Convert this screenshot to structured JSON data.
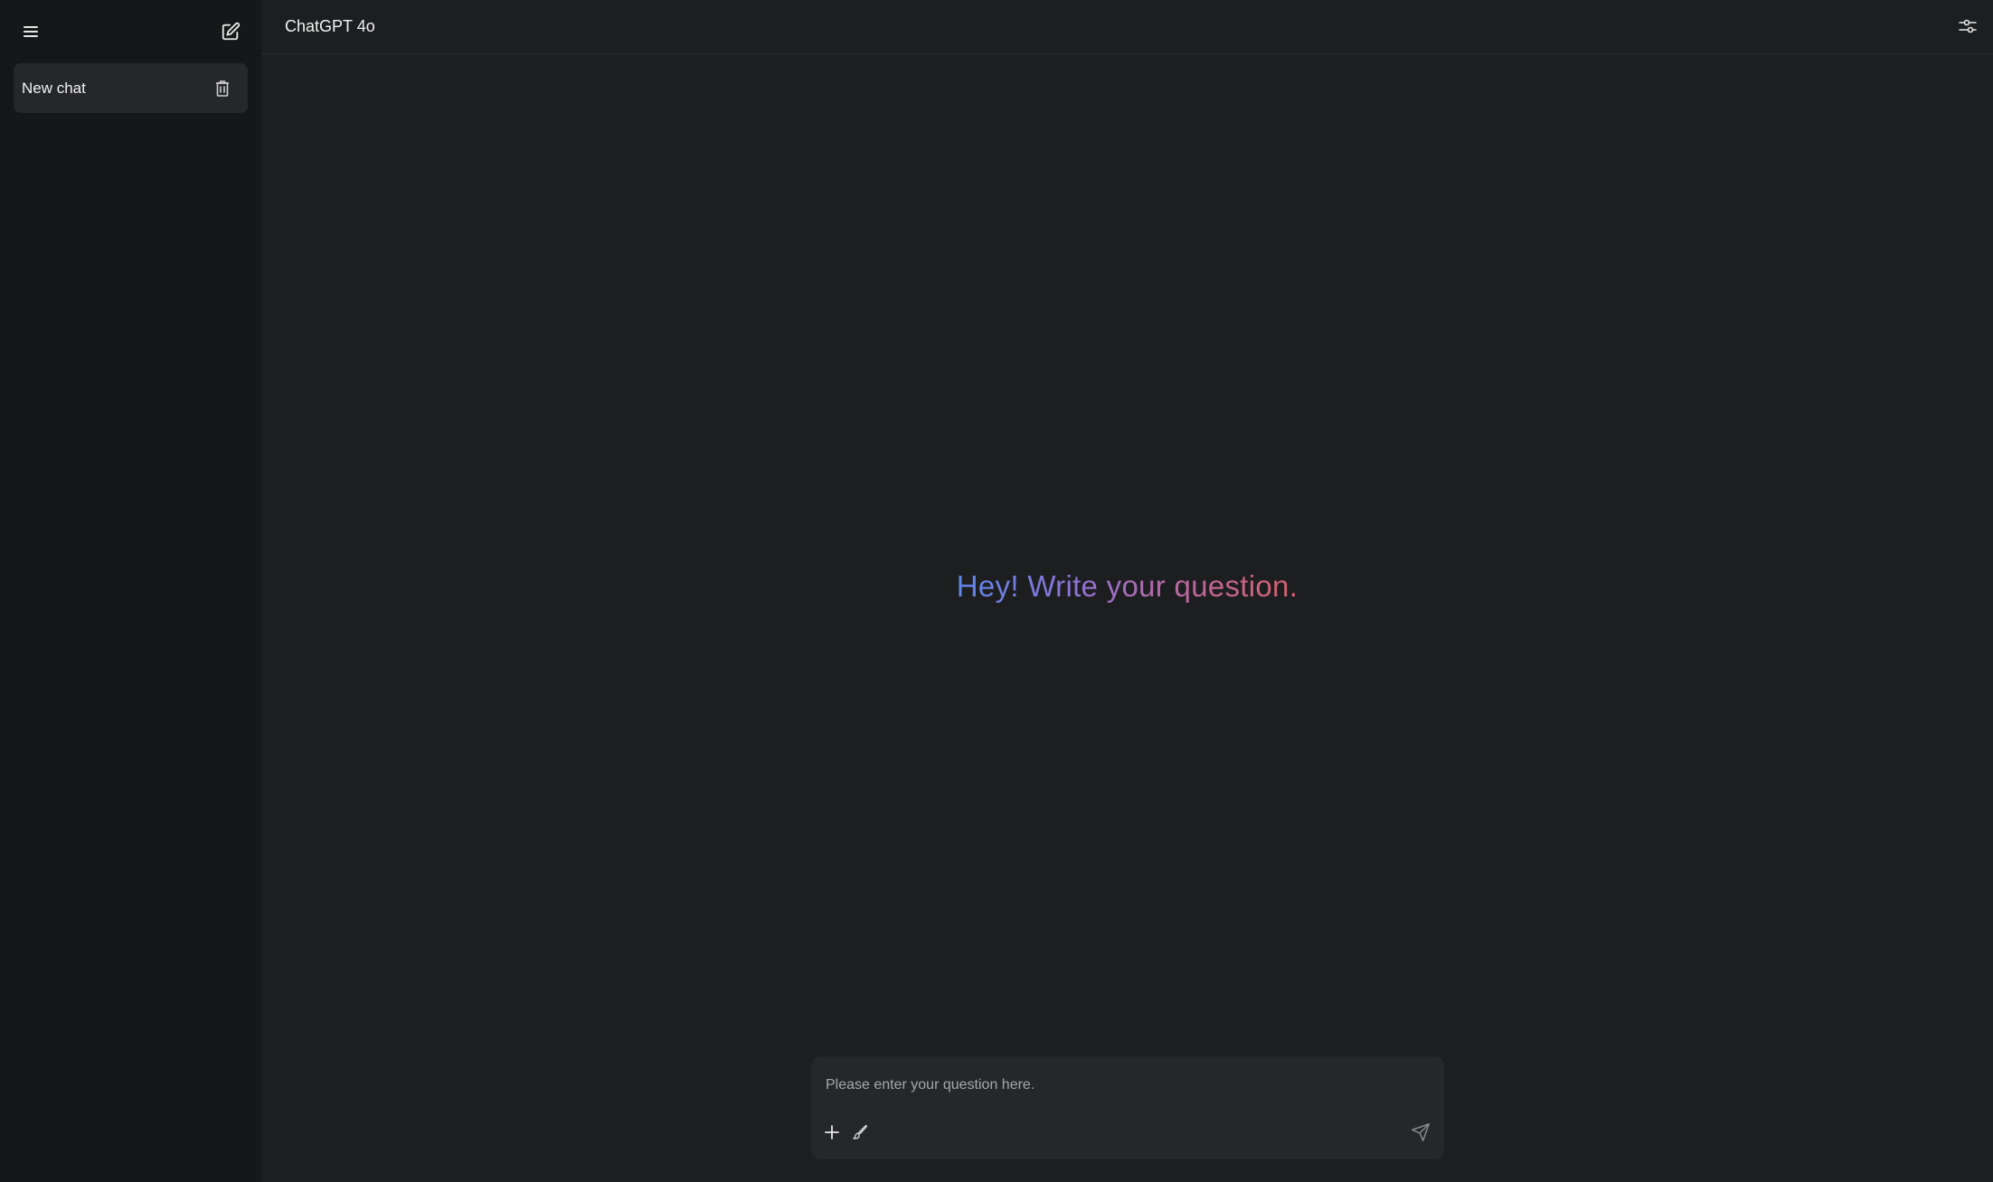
{
  "sidebar": {
    "menu_icon": "hamburger-menu-icon",
    "new_chat_icon": "edit-square-icon",
    "chats": [
      {
        "label": "New chat",
        "delete_icon": "trash-icon"
      }
    ]
  },
  "header": {
    "title": "ChatGPT 4o",
    "settings_icon": "sliders-icon"
  },
  "main": {
    "welcome": "Hey! Write your question."
  },
  "composer": {
    "placeholder": "Please enter your question here.",
    "value": "",
    "attach_icon": "plus-icon",
    "brush_icon": "brush-icon",
    "send_icon": "send-icon"
  },
  "colors": {
    "background": "#1d1e20",
    "sidebar": "#161718",
    "panel": "#26272a",
    "gradient": [
      "#5d86e8",
      "#8e72d6",
      "#b66aa8",
      "#d4606d"
    ]
  }
}
